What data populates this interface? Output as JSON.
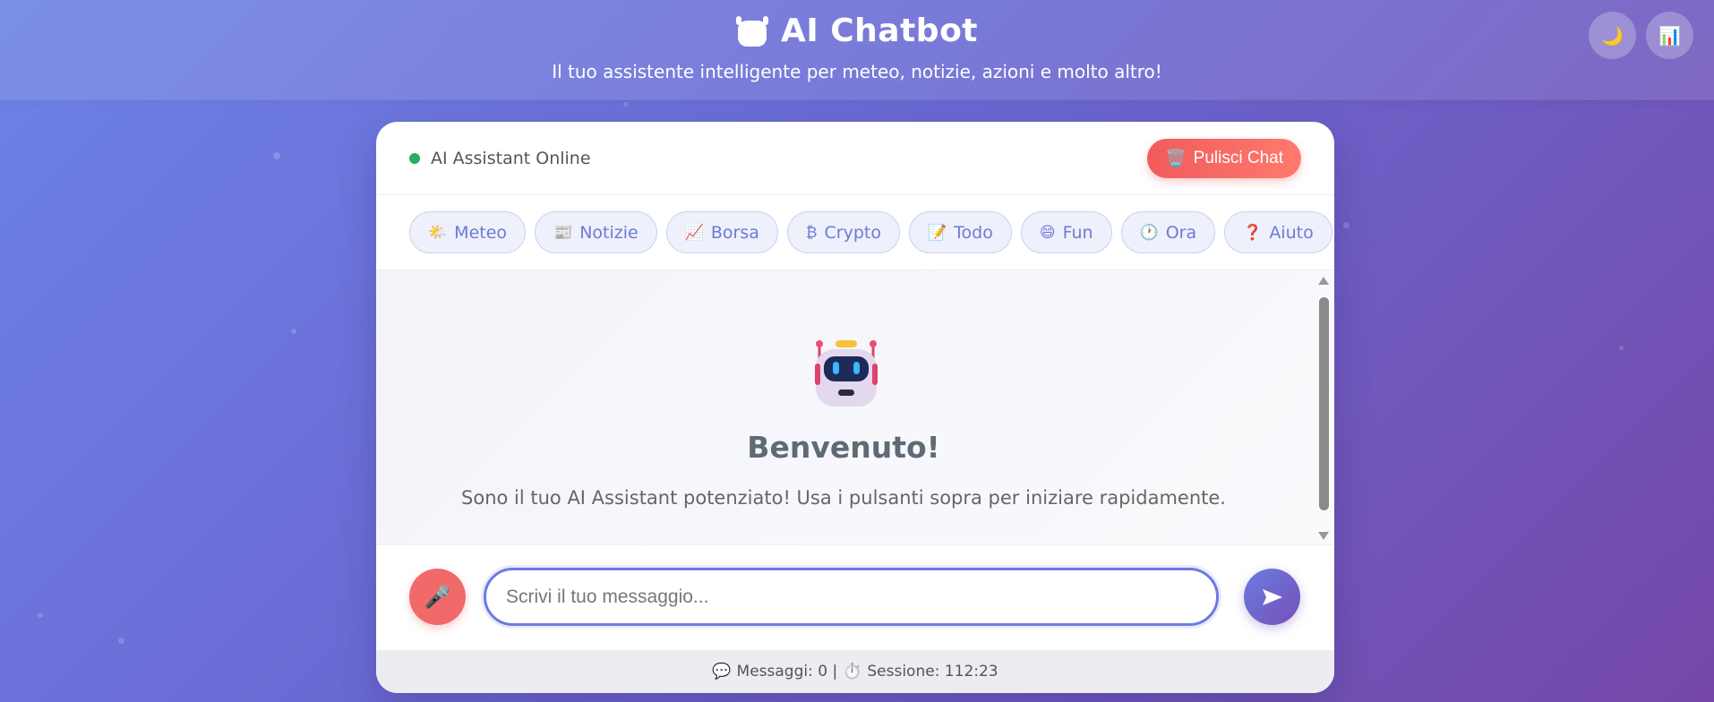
{
  "header": {
    "title": "AI Chatbot",
    "subtitle": "Il tuo assistente intelligente per meteo, notizie, azioni e molto altro!",
    "theme_toggle_icon": "🌙",
    "stats_icon": "📊"
  },
  "chat": {
    "status_text": "AI Assistant Online",
    "status_color": "#27ae60",
    "clear_button": {
      "icon": "🗑️",
      "label": "Pulisci Chat"
    },
    "quick_actions": [
      {
        "icon": "🌤️",
        "label": "Meteo"
      },
      {
        "icon": "📰",
        "label": "Notizie"
      },
      {
        "icon": "📈",
        "label": "Borsa"
      },
      {
        "icon": "₿",
        "label": "Crypto"
      },
      {
        "icon": "📝",
        "label": "Todo"
      },
      {
        "icon": "😄",
        "label": "Fun"
      },
      {
        "icon": "🕐",
        "label": "Ora"
      },
      {
        "icon": "❓",
        "label": "Aiuto"
      }
    ],
    "welcome": {
      "title": "Benvenuto!",
      "text": "Sono il tuo AI Assistant potenziato! Usa i pulsanti sopra per iniziare rapidamente."
    },
    "input": {
      "placeholder": "Scrivi il tuo messaggio...",
      "mic_icon": "🎤",
      "send_icon": "➤"
    },
    "footer": {
      "messages_icon": "💬",
      "messages_text": "Messaggi: 0 |",
      "session_icon": "⏱️",
      "session_text": "Sessione: 112:23"
    }
  },
  "colors": {
    "accent": "#6b7be0",
    "danger": "#f15b5b"
  }
}
